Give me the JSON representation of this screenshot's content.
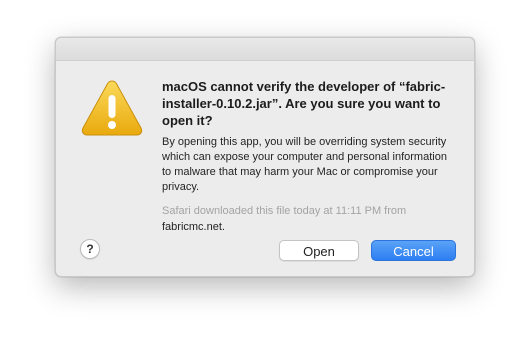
{
  "dialog": {
    "icon": "warning-icon",
    "headline": "macOS cannot verify the developer of “fabric-installer-0.10.2.jar”. Are you sure you want to open it?",
    "body": "By opening this app, you will be overriding system security which can expose your computer and personal information to malware that may harm your Mac or compromise your privacy.",
    "source_prefix": "Safari downloaded this file today at 11:11 PM from",
    "source_domain": "fabricmc.net",
    "source_suffix": ".",
    "help_label": "?",
    "open_label": "Open",
    "cancel_label": "Cancel"
  },
  "colors": {
    "accent": "#2d7ef2",
    "warning_yellow": "#f2c21b",
    "background": "#ececec"
  }
}
